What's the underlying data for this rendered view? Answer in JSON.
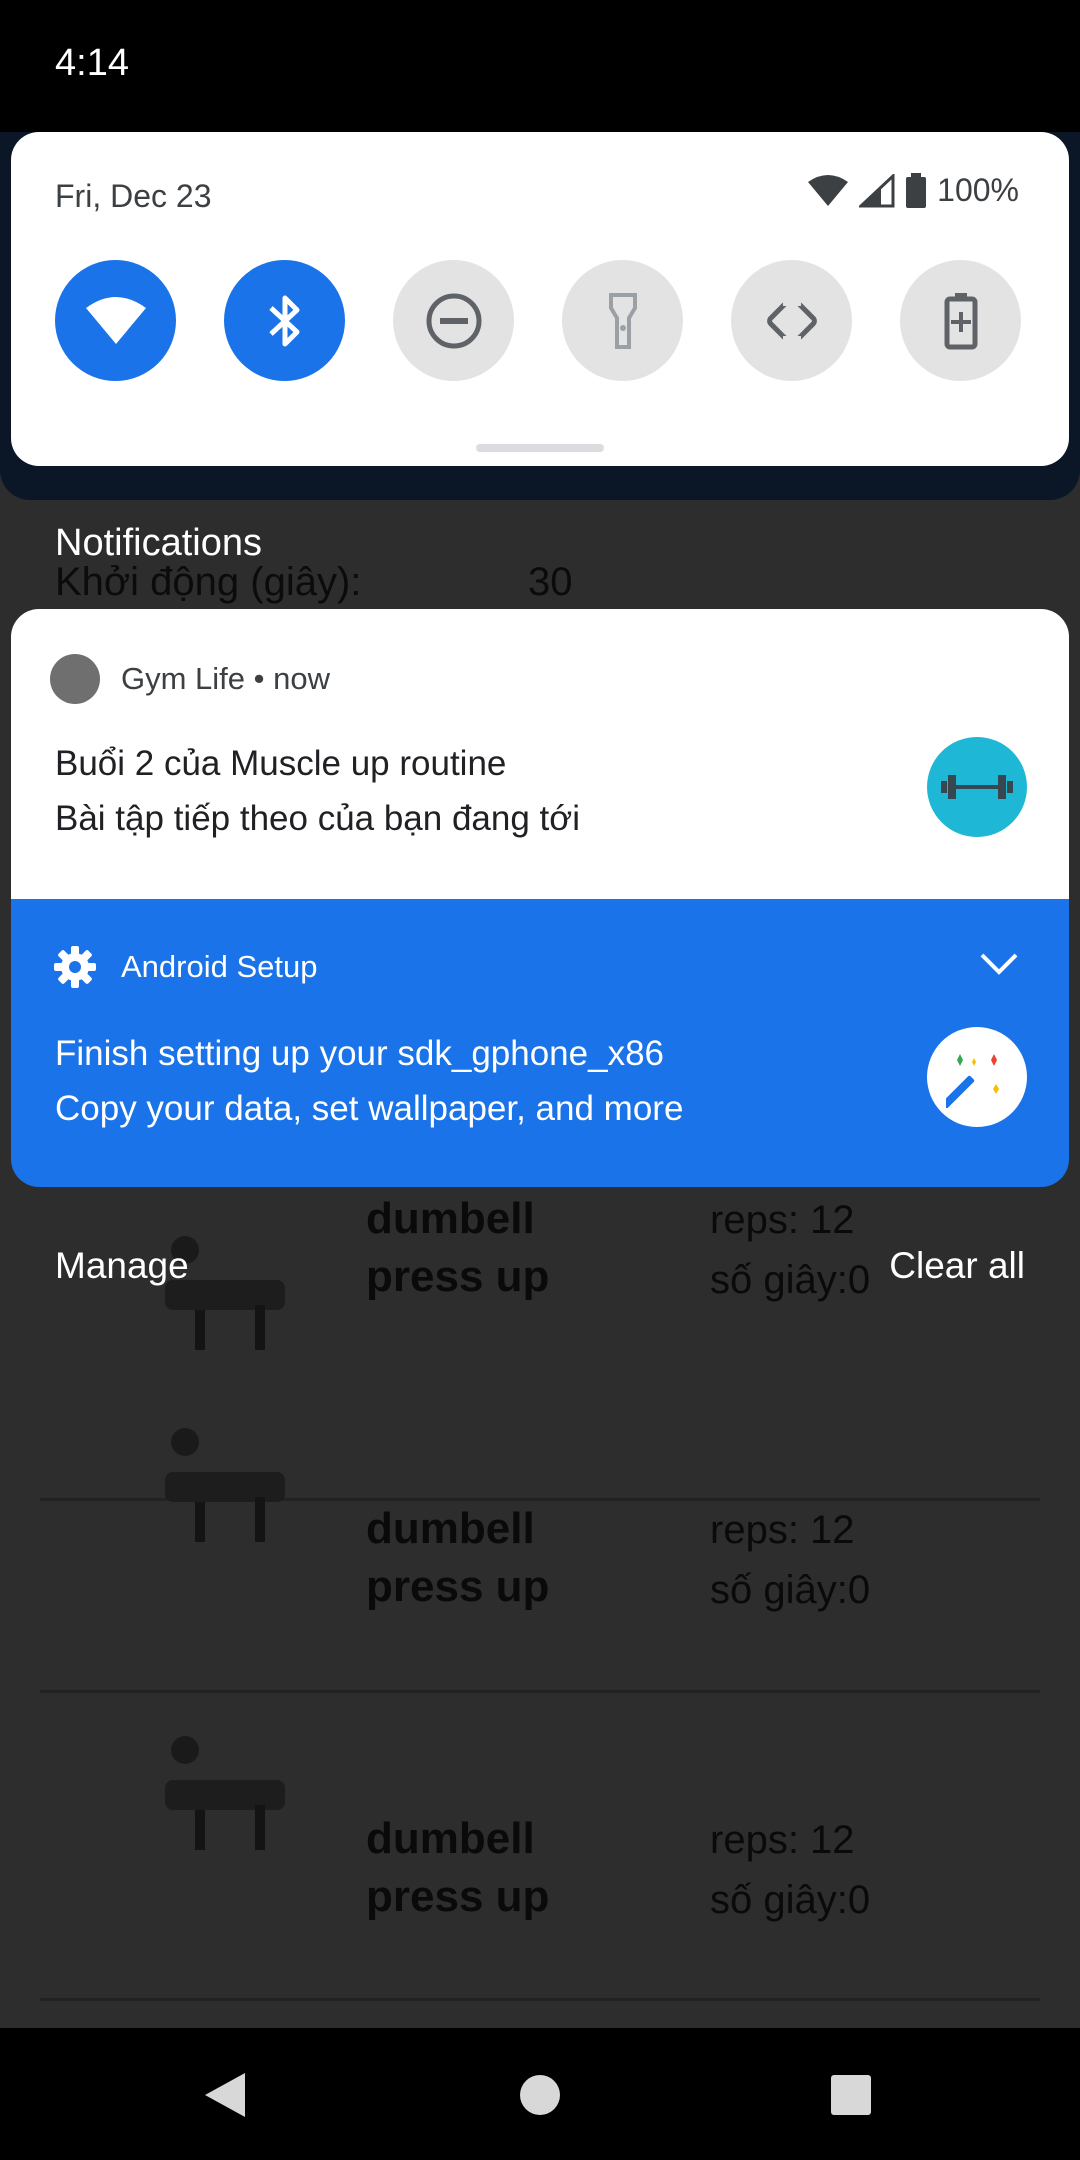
{
  "status_bar": {
    "time": "4:14"
  },
  "quick_settings": {
    "date": "Fri, Dec 23",
    "battery": "100%",
    "tiles": [
      {
        "name": "wifi",
        "state": "on"
      },
      {
        "name": "bluetooth",
        "state": "on"
      },
      {
        "name": "do-not-disturb",
        "state": "off"
      },
      {
        "name": "flashlight",
        "state": "off"
      },
      {
        "name": "auto-rotate",
        "state": "off"
      },
      {
        "name": "battery-saver",
        "state": "off"
      }
    ]
  },
  "notifications_header": "Notifications",
  "background_app": {
    "top_label": "Khởi động (giây):",
    "top_value": "30",
    "exercises": [
      {
        "name": "dumbell press up",
        "reps": "reps: 12",
        "seconds": "số giây:0"
      },
      {
        "name": "dumbell press up",
        "reps": "reps: 12",
        "seconds": "số giây:0"
      },
      {
        "name": "dumbell press up",
        "reps": "reps: 12",
        "seconds": "số giây:0"
      }
    ]
  },
  "notifications": [
    {
      "app": "Gym Life",
      "time": "now",
      "title": "Buổi 2 của Muscle up routine",
      "text": "Bài tập tiếp theo của bạn đang tới"
    },
    {
      "app": "Android Setup",
      "title": "Finish setting up your sdk_gphone_x86",
      "text": "Copy your data, set wallpaper, and more"
    }
  ],
  "actions": {
    "manage": "Manage",
    "clear_all": "Clear all"
  },
  "colors": {
    "accent": "#1a73e8",
    "gym_icon": "#1fb7d6"
  }
}
